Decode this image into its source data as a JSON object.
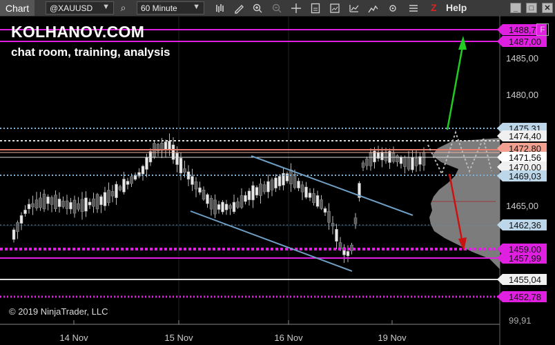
{
  "toolbar": {
    "tab_label": "Chart",
    "instrument": "@XAUUSD",
    "interval": "60 Minute",
    "help_label": "Help",
    "z_label": "Z"
  },
  "overlay": {
    "brand": "KOLHANOV.COM",
    "tagline": "chat room, training, analysis",
    "copyright": "© 2019 NinjaTrader, LLC",
    "corner_button": "F"
  },
  "colors": {
    "background": "#000000",
    "bull_candle": "#e8e8e8",
    "bear_candle": "#5a5a5a",
    "magenta": "#e020e0",
    "dotted_blue": "#7fb2d9",
    "salmon": "#e77e6e",
    "channel": "#6f9fc4",
    "up_arrow": "#22cc22",
    "down_arrow": "#cc1111"
  },
  "chart_data": {
    "type": "candlestick",
    "instrument": "@XAUUSD",
    "timeframe": "60 Minute",
    "x_ticks": [
      "14 Nov",
      "15 Nov",
      "16 Nov",
      "19 Nov"
    ],
    "y_ticks": [
      "1485,00",
      "1480,00",
      "1465,00"
    ],
    "price_labels": [
      {
        "text": "1488,7",
        "kind": "magenta"
      },
      {
        "text": "1487,00",
        "kind": "magenta"
      },
      {
        "text": "1475,31",
        "kind": "blue"
      },
      {
        "text": "1474,40",
        "kind": "white"
      },
      {
        "text": "1472,80",
        "kind": "salmon"
      },
      {
        "text": "1471,56",
        "kind": "last"
      },
      {
        "text": "1470,00",
        "kind": "white"
      },
      {
        "text": "1469,03",
        "kind": "blue"
      },
      {
        "text": "1462,36",
        "kind": "blue"
      },
      {
        "text": "1459,00",
        "kind": "magenta"
      },
      {
        "text": "1457,99",
        "kind": "magenta"
      },
      {
        "text": "1455,04",
        "kind": "white"
      },
      {
        "text": "1452,78",
        "kind": "magenta"
      },
      {
        "text": "99,91",
        "kind": "plain"
      }
    ]
  }
}
